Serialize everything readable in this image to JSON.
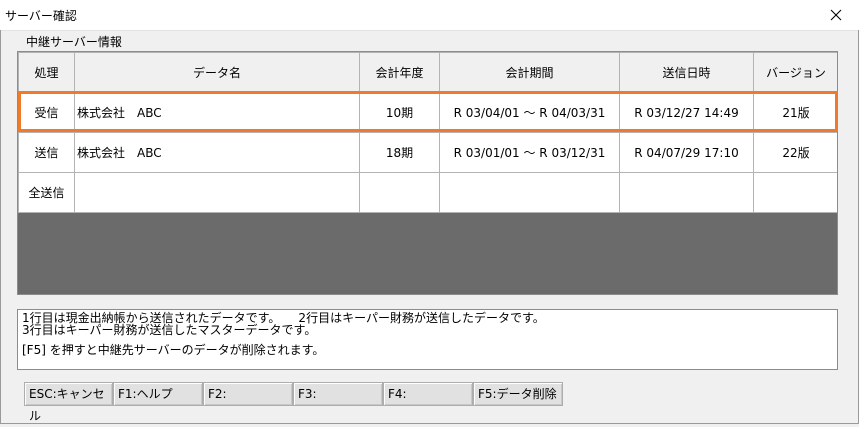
{
  "window": {
    "title": "サーバー確認"
  },
  "section_label": "中継サーバー情報",
  "table": {
    "columns": [
      "処理",
      "データ名",
      "会計年度",
      "会計期間",
      "送信日時",
      "バージョン"
    ],
    "rows": [
      {
        "action": "受信",
        "name": "株式会社　ABC",
        "year": "10期",
        "period": "R 03/04/01 〜 R 04/03/31",
        "sent": "R 03/12/27 14:49",
        "version": "21版"
      },
      {
        "action": "送信",
        "name": "株式会社　ABC",
        "year": "18期",
        "period": "R 03/01/01 〜 R 03/12/31",
        "sent": "R 04/07/29 17:10",
        "version": "22版"
      },
      {
        "action": "全送信",
        "name": "",
        "year": "",
        "period": "",
        "sent": "",
        "version": ""
      }
    ]
  },
  "notes": {
    "line1": "1行目は現金出納帳から送信されたデータです。　　2行目はキーパー財務が送信したデータです。",
    "line2": "3行目はキーパー財務が送信したマスターデータです。",
    "line3": "[F5] を押すと中継先サーバーのデータが削除されます。"
  },
  "buttons": {
    "esc": "ESC:キャンセル",
    "f1": "F1:ヘルプ",
    "f2": "F2:",
    "f3": "F3:",
    "f4": "F4:",
    "f5": "F5:データ削除"
  },
  "colors": {
    "selection": "#f07a2c",
    "grid_empty": "#6b6b6b"
  }
}
